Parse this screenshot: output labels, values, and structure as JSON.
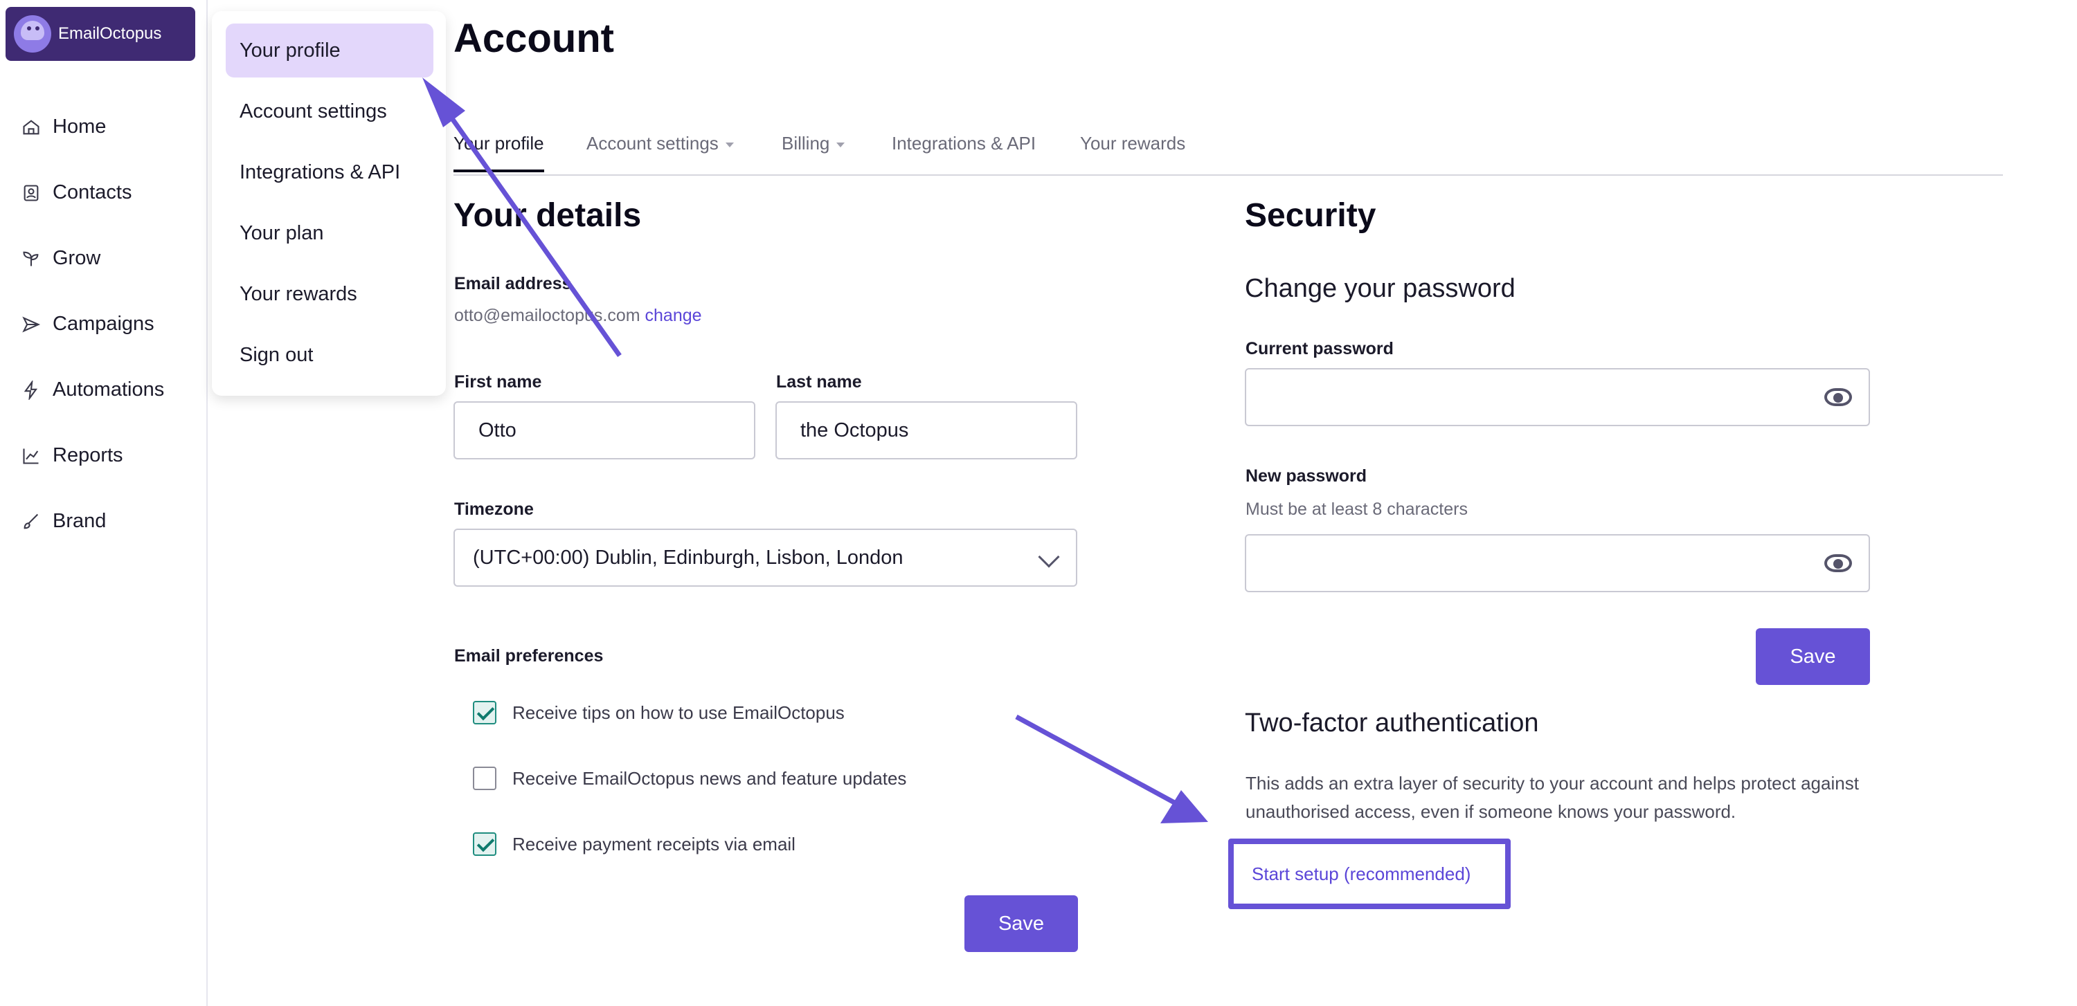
{
  "brand": {
    "name": "EmailOctopus"
  },
  "sidebar": {
    "items": [
      {
        "label": "Home",
        "icon": "home-icon"
      },
      {
        "label": "Contacts",
        "icon": "contacts-icon"
      },
      {
        "label": "Grow",
        "icon": "sprout-icon"
      },
      {
        "label": "Campaigns",
        "icon": "send-icon"
      },
      {
        "label": "Automations",
        "icon": "bolt-icon"
      },
      {
        "label": "Reports",
        "icon": "chart-line-icon"
      },
      {
        "label": "Brand",
        "icon": "brush-icon"
      }
    ]
  },
  "dropdown": {
    "items": [
      "Your profile",
      "Account settings",
      "Integrations & API",
      "Your plan",
      "Your rewards",
      "Sign out"
    ],
    "active": "Your profile"
  },
  "page": {
    "title": "Account"
  },
  "tabs": [
    {
      "label": "Your profile",
      "active": true
    },
    {
      "label": "Account settings",
      "caret": true
    },
    {
      "label": "Billing",
      "caret": true
    },
    {
      "label": "Integrations & API"
    },
    {
      "label": "Your rewards"
    }
  ],
  "details": {
    "heading": "Your details",
    "email_label": "Email address",
    "email_value": "otto@emailoctopus.com",
    "email_change": "change",
    "first_name_label": "First name",
    "first_name_value": "Otto",
    "last_name_label": "Last name",
    "last_name_value": "the Octopus",
    "timezone_label": "Timezone",
    "timezone_value": "(UTC+00:00) Dublin, Edinburgh, Lisbon, London",
    "prefs_label": "Email preferences",
    "prefs": [
      {
        "label": "Receive tips on how to use EmailOctopus",
        "checked": true
      },
      {
        "label": "Receive EmailOctopus news and feature updates",
        "checked": false
      },
      {
        "label": "Receive payment receipts via email",
        "checked": true
      }
    ],
    "save_label": "Save"
  },
  "security": {
    "heading": "Security",
    "change_heading": "Change your password",
    "current_label": "Current password",
    "new_label": "New password",
    "new_hint": "Must be at least 8 characters",
    "save_label": "Save",
    "tfa_heading": "Two-factor authentication",
    "tfa_desc_line1": "This adds an extra layer of security to your account and helps protect against",
    "tfa_desc_line2": "unauthorised access, even if someone knows your password.",
    "tfa_link": "Start setup (recommended)"
  },
  "colors": {
    "accent": "#6652d6",
    "brand_bg": "#3f2a73",
    "active_menu": "#e3d7fb",
    "check": "#0f7a6d"
  }
}
